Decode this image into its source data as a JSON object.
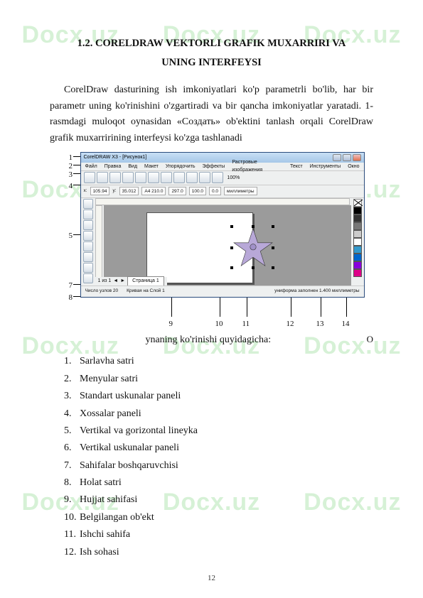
{
  "watermark": "Docx.uz",
  "heading1": "1.2. CORELDRAW VEKTORLI GRAFIK MUXARRIRI VA",
  "heading2": "UNING INTERFEYSI",
  "paragraph": "CorelDraw dasturining ish imkoniyatlari ko'p parametrli bo'lib, har bir parametr uning ko'rinishini o'zgartiradi va bir qancha imkoniyatlar yaratadi. 1-rasmdagi muloqot oynasidan «Создать» ob'ektini tanlash orqali CorelDraw grafik muxarririning interfeysi ko'zga tashlanadi",
  "app": {
    "title": "CorelDRAW X3 - [Рисунок1]",
    "menu": [
      "Файл",
      "Правка",
      "Вид",
      "Макет",
      "Упорядочить",
      "Эффекты",
      "Растровые изображения",
      "Текст",
      "Инструменты",
      "Окно"
    ],
    "props": {
      "x": "105.94",
      "y": "35.012",
      "w": "A4  210.0",
      "h": "297.0",
      "scale": "100.0",
      "angle": "0.0",
      "units": "миллиметры"
    },
    "page_tab": "Страница 1",
    "page_of": "1 из 1",
    "status_left": "Число узлов 20",
    "status_mid": "Кривая на Слой 1",
    "status_right": "униформа заполнен  1.400 миллиметры"
  },
  "callouts_left": [
    "1",
    "2",
    "3",
    "4",
    "5",
    "7",
    "8"
  ],
  "callouts_bottom": [
    "9",
    "10",
    "11",
    "12",
    "13",
    "14"
  ],
  "caption_o": "O",
  "caption_center": "ynaning ko'rinishi quyidagicha:",
  "list": [
    "Sarlavha satri",
    "Menyular satri",
    "Standart uskunalar paneli",
    "Xossalar paneli",
    "Vertikal va gorizontal lineyka",
    "Vertikal uskunalar paneli",
    "Sahifalar boshqaruvchisi",
    "Holat satri",
    "Hujjat sahifasi",
    "Belgilangan ob'ekt",
    "Ishchi sahifa",
    "Ish sohasi"
  ],
  "page_number": "12"
}
